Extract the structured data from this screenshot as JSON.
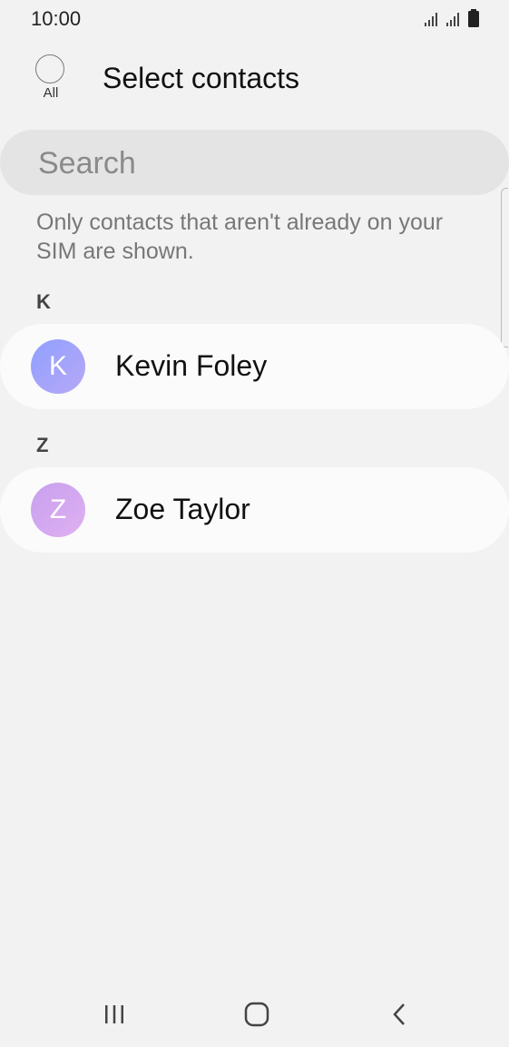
{
  "status_bar": {
    "time": "10:00",
    "icons": [
      "signal-icon",
      "signal-icon",
      "battery-icon"
    ]
  },
  "header": {
    "select_all_label": "All",
    "title": "Select contacts"
  },
  "search": {
    "placeholder": "Search",
    "value": ""
  },
  "notice": "Only contacts that aren't already on your SIM are shown.",
  "sections": [
    {
      "letter": "K",
      "contacts": [
        {
          "initial": "K",
          "name": "Kevin Foley"
        }
      ]
    },
    {
      "letter": "Z",
      "contacts": [
        {
          "initial": "Z",
          "name": "Zoe Taylor"
        }
      ]
    }
  ],
  "nav_bar": {
    "buttons": [
      "recent-apps-icon",
      "home-icon",
      "back-icon"
    ]
  },
  "colors": {
    "background": "#f2f2f2",
    "search_background": "#e4e4e4",
    "row_background": "#fbfbfb",
    "avatar_k": "#9fa4fa",
    "avatar_z": "#d3a8f0"
  }
}
